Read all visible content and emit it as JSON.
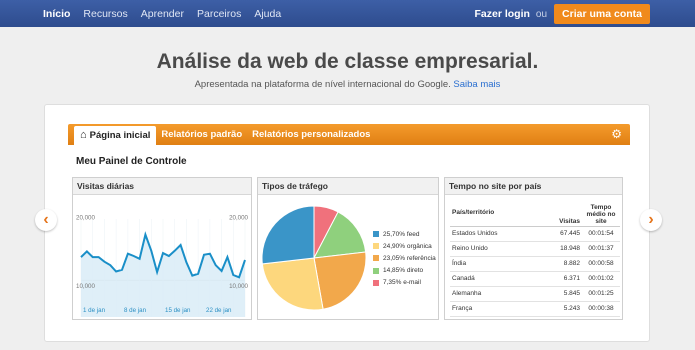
{
  "nav": {
    "items": [
      "Início",
      "Recursos",
      "Aprender",
      "Parceiros",
      "Ajuda"
    ],
    "login": "Fazer login",
    "or": "ou",
    "create_account": "Criar uma conta"
  },
  "hero": {
    "title": "Análise da web de classe empresarial.",
    "subtitle": "Apresentada na plataforma de nível internacional do Google.",
    "learn_more": "Saiba mais"
  },
  "tabs": {
    "home": "Página inicial",
    "standard": "Relatórios padrão",
    "custom": "Relatórios personalizados"
  },
  "dashboard": {
    "title": "Meu Painel de Controle"
  },
  "visits_widget": {
    "title": "Visitas diárias",
    "y_ticks": [
      "20,000",
      "10,000"
    ],
    "x_ticks": [
      "1 de jan",
      "8 de jan",
      "15 de jan",
      "22 de jan"
    ]
  },
  "traffic_widget": {
    "title": "Tipos de tráfego"
  },
  "geo_widget": {
    "title": "Tempo no site por país",
    "headers": [
      "País/território",
      "Visitas",
      "Tempo médio no site"
    ],
    "rows": [
      [
        "Estados Unidos",
        "67.445",
        "00:01:54"
      ],
      [
        "Reino Unido",
        "18.948",
        "00:01:37"
      ],
      [
        "Índia",
        "8.882",
        "00:00:58"
      ],
      [
        "Canadá",
        "6.371",
        "00:01:02"
      ],
      [
        "Alemanha",
        "5.845",
        "00:01:25"
      ],
      [
        "França",
        "5.243",
        "00:00:38"
      ]
    ]
  },
  "chart_data": [
    {
      "type": "line",
      "title": "Visitas diárias",
      "x": [
        "1 de jan",
        "2",
        "3",
        "4",
        "5",
        "6",
        "7",
        "8 de jan",
        "9",
        "10",
        "11",
        "12",
        "13",
        "14",
        "15 de jan",
        "16",
        "17",
        "18",
        "19",
        "20",
        "21",
        "22 de jan",
        "23",
        "24",
        "25",
        "26",
        "27",
        "28",
        "29"
      ],
      "x_ticks": [
        "1 de jan",
        "8 de jan",
        "15 de jan",
        "22 de jan"
      ],
      "y_ticks": [
        "20,000",
        "10,000"
      ],
      "ylim": [
        5000,
        22000
      ],
      "values": [
        14000,
        15000,
        14000,
        14000,
        13200,
        12600,
        11500,
        11800,
        14600,
        14200,
        13700,
        17900,
        15100,
        11400,
        14700,
        14200,
        15100,
        16100,
        13100,
        10800,
        11100,
        14400,
        14600,
        12600,
        11600,
        14000,
        10900,
        10500,
        13500
      ],
      "color": "#1a8fc8",
      "area_color": "#d9ecf7"
    },
    {
      "type": "pie",
      "title": "Tipos de tráfego",
      "labels": [
        "feed",
        "orgânica",
        "referência",
        "direto",
        "e-mail"
      ],
      "values": [
        25.7,
        24.9,
        23.05,
        14.85,
        7.35
      ],
      "display": [
        "25,70% feed",
        "24,90% orgânica",
        "23,05% referência",
        "14,85% direto",
        "7,35% e-mail"
      ],
      "colors": [
        "#3a95c8",
        "#fdd77d",
        "#f2a84b",
        "#8fd07d",
        "#f0717c"
      ]
    }
  ],
  "colors": {
    "accent": "#f08a1c",
    "nav_bg": "#2e4c8e",
    "link": "#2a6fd0"
  }
}
